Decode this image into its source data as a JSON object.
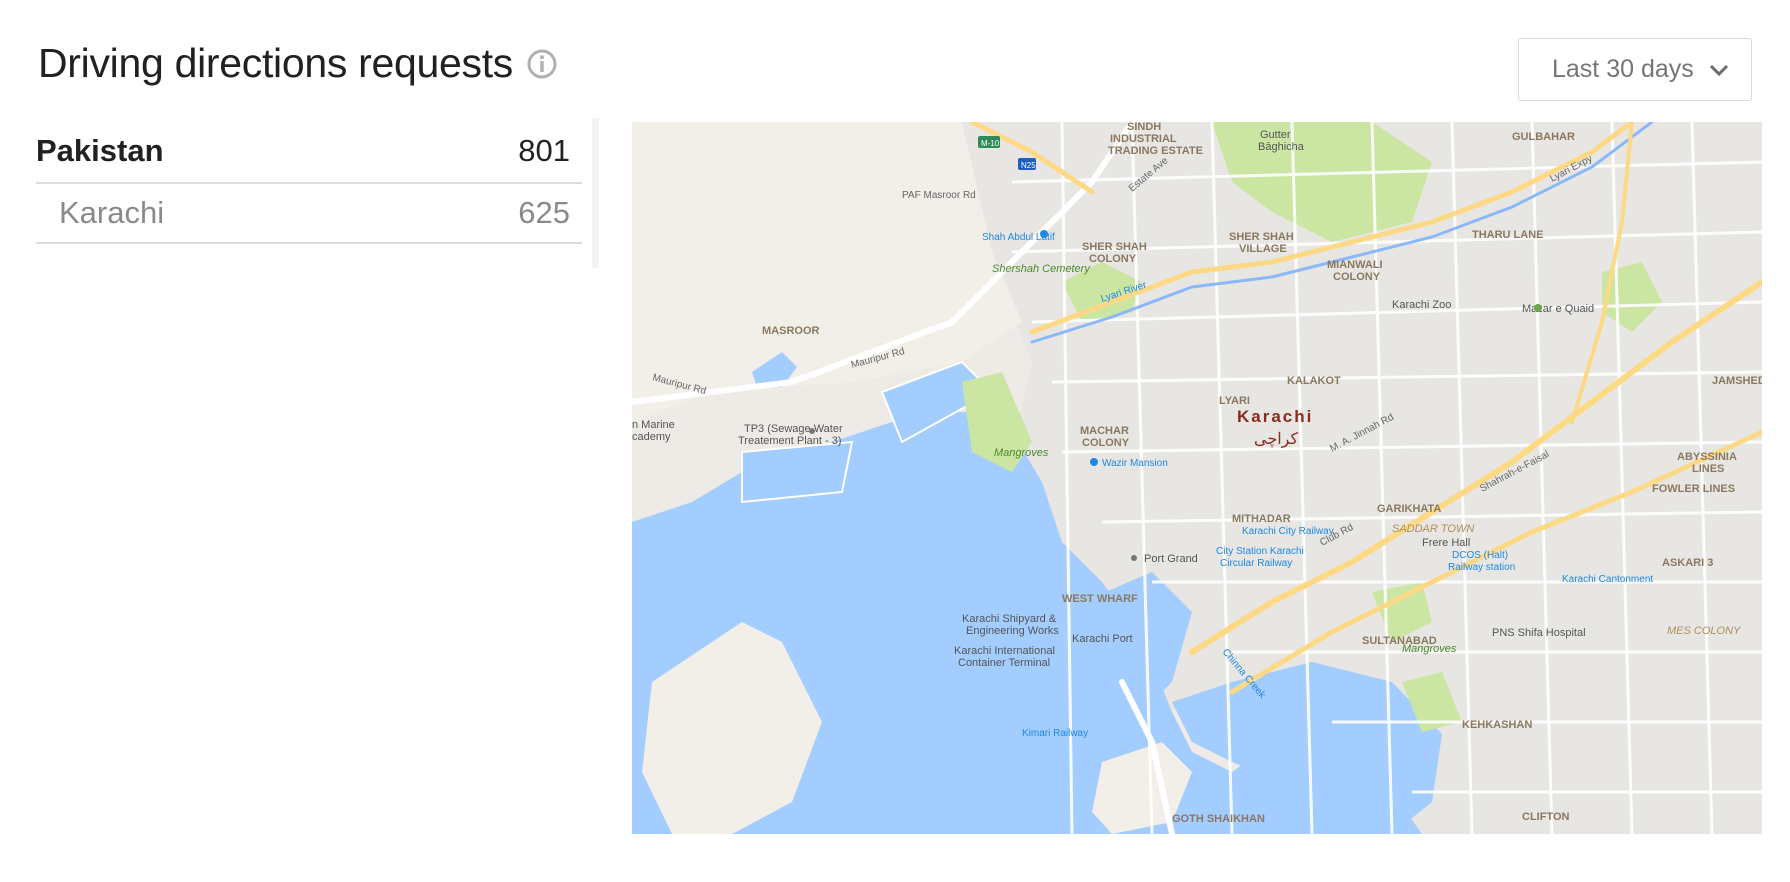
{
  "header": {
    "title": "Driving directions requests",
    "info_icon": "info-circle-icon"
  },
  "range_select": {
    "selected": "Last 30 days",
    "icon": "chevron-down-icon"
  },
  "locations": [
    {
      "name": "Pakistan",
      "count": "801"
    },
    {
      "name": "Karachi",
      "count": "625"
    }
  ],
  "map": {
    "labels": {
      "city": "Karachi",
      "city_ur": "کراچی",
      "sindh": "SINDH",
      "industrial": "INDUSTRIAL",
      "trading": "TRADING ESTATE",
      "gutter": "Gutter",
      "baghicha": "Bāghicha",
      "gulbahar": "GULBAHAR",
      "masroor": "MASROOR",
      "shershah_village": "SHER SHAH",
      "village": "VILLAGE",
      "shershah_colony": "SHER SHAH",
      "colony": "COLONY",
      "shershah_cemetery": "Shershah Cemetery",
      "mianwali": "MIANWALI",
      "mianwali_colony": "COLONY",
      "tharu_lane": "THARU LANE",
      "karachi_zoo": "Karachi Zoo",
      "mazar": "Mazar e Quaid",
      "jamshed": "JAMSHED TO",
      "kalakot": "KALAKOT",
      "lyari": "LYARI",
      "machar": "MACHAR",
      "machar_colony": "COLONY",
      "mangroves": "Mangroves",
      "mangroves2": "Mangroves",
      "tp3a": "TP3 (Sewage Water",
      "tp3b": "Treatement Plant - 3)",
      "marine_a": "n Marine",
      "marine_b": "cademy",
      "wazir": "Wazir Mansion",
      "mithadar": "MITHADAR",
      "garikhata": "GARIKHATA",
      "saddar": "SADDAR TOWN",
      "abyssinia": "ABYSSINIA",
      "lines": "LINES",
      "fowler": "FOWLER LINES",
      "askari": "ASKARI 3",
      "west_wharf": "WEST WHARF",
      "port_grand": "Port Grand",
      "city_station_a": "City Station Karachi",
      "city_station_b": "Circular Railway",
      "karachi_city_rail": "Karachi City Railway",
      "dcos_a": "DCOS (Halt)",
      "dcos_b": "Railway station",
      "frere": "Frere Hall",
      "karachi_cantonment": "Karachi Cantonment",
      "mes": "MES COLONY",
      "sultanabad": "SULTANABAD",
      "shipyard_a": "Karachi Shipyard &",
      "shipyard_b": "Engineering Works",
      "kict_a": "Karachi International",
      "kict_b": "Container Terminal",
      "karachi_port": "Karachi Port",
      "chinna_creek": "Chinna Creek",
      "kehkashan": "KEHKASHAN",
      "pns_shifa": "PNS Shifa Hospital",
      "goth": "GOTH SHAIKHAN",
      "clifton": "CLIFTON",
      "kimari": "Kimari Railway",
      "shah_abdul": "Shah Abdul Latif",
      "lyari_river": "Lyari River",
      "lyari_expy": "Lyari Expy",
      "mauripur": "Mauripur Rd",
      "mauripur2": "Mauripur Rd",
      "paf": "PAF Masroor Rd",
      "estate_ave": "Estate Ave",
      "jinnah": "M. A. Jinnah Rd",
      "shahrae_faisal": "Shahrah-e-Faisal",
      "club_rd": "Club Rd",
      "m10": "M-10",
      "n25": "N25"
    }
  }
}
